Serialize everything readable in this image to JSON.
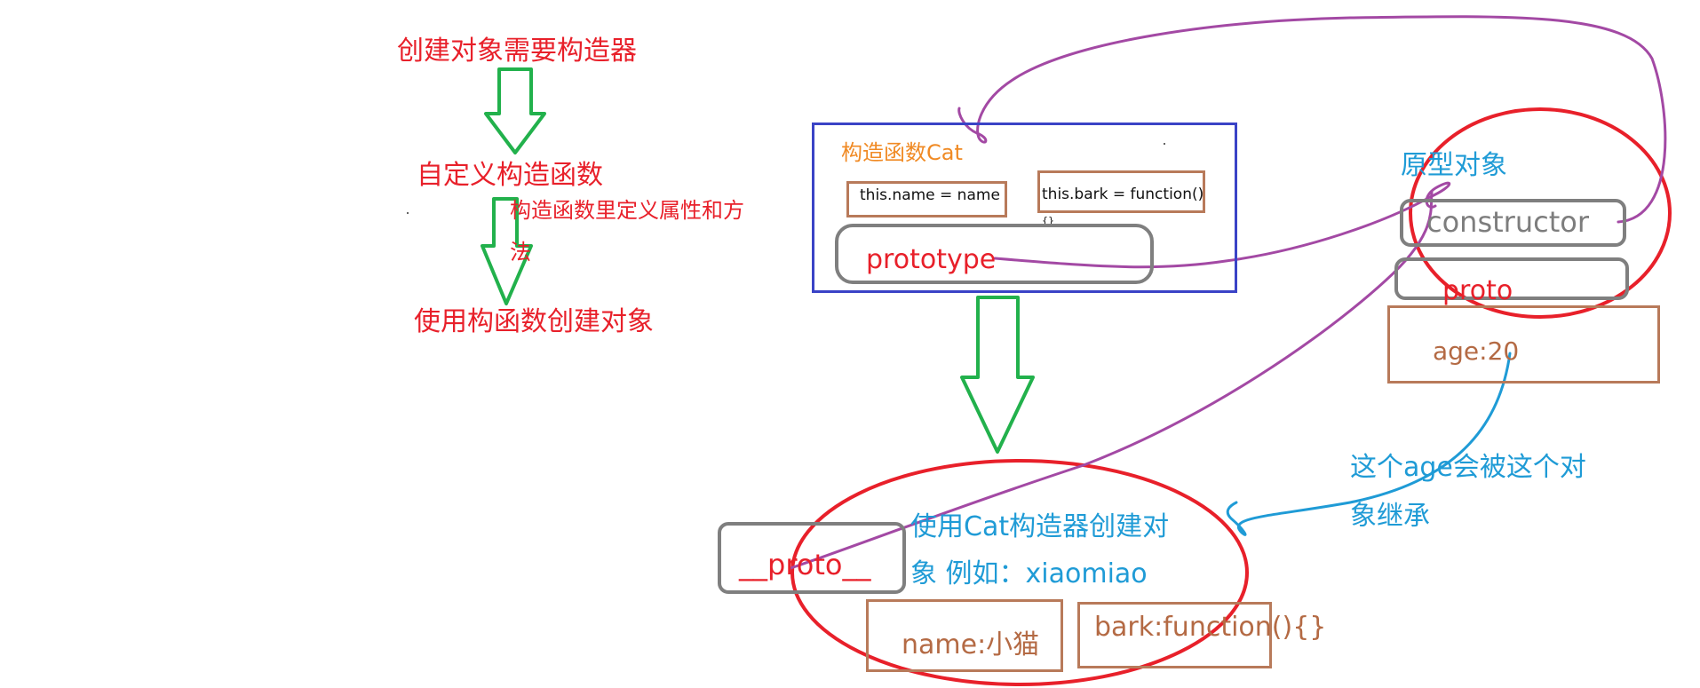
{
  "left_flow": {
    "step1": "创建对象需要构造器",
    "step2": "自定义构造函数",
    "step2_note_line1": "构造函数里定义属性和方",
    "step2_note_line2": "法",
    "step3": "使用构函数创建对象"
  },
  "constructor_box": {
    "title": "构造函数Cat",
    "field_name": "this.name = name",
    "field_bark_line1": "this.bark = function()",
    "field_bark_line2": "{}",
    "prototype_label": "prototype"
  },
  "prototype_object": {
    "title": "原型对象",
    "constructor_label": "constructor",
    "proto_label": "proto",
    "age_label": "age:20"
  },
  "inherit_note": {
    "line1": "这个age会被这个对",
    "line2": "象继承"
  },
  "instance": {
    "title_line1": "使用Cat构造器创建对",
    "title_line2": "象 例如：xiaomiao",
    "proto_label": "__proto__",
    "name_label": "name:小猫",
    "bark_label": "bark:function(){}"
  },
  "colors": {
    "red": "#e8202a",
    "green": "#22b14c",
    "purple": "#a349a4",
    "blue_box": "#3a43c6",
    "brown_box": "#b87a5a",
    "gray_box": "#7f7f7f",
    "orange_text": "#f08a24",
    "blue_text": "#1f9bd6"
  }
}
